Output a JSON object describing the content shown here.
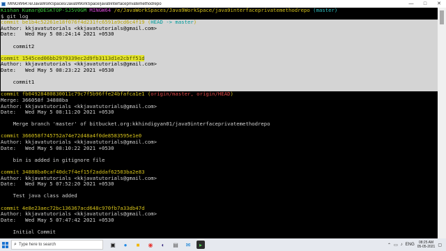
{
  "window": {
    "title": "MINGW64:/e/JavaWorkSpaces/Java9WorkSpace/java9interfaceprivatemethodrepo",
    "minimize_icon": "minimize-icon",
    "maximize_icon": "maximize-icon",
    "close_icon": "close-icon"
  },
  "prompt": {
    "user": "Kishan Kumar@DESKTOP-SJ5V0GM",
    "shell": "MINGW64",
    "path": "/e/JavaWorkSpaces/Java9WorkSpace/java9interfaceprivatemethodrepo",
    "branch": "(master)",
    "command": "$ git log"
  },
  "commits": [
    {
      "commit_line": "commit be1b4c52261e18f076f4d231fc6591a9cd6c4f19",
      "refs_open": " (",
      "refs_head": "HEAD -> master",
      "refs_close": ")",
      "author": "Author: kkjavatutorials <kkjavatutorials@gmail.com>",
      "date": "Date:   Wed May 5 08:24:14 2021 +0530",
      "message": "    commit2"
    },
    {
      "commit_line": "commit 1545ced06bb2979339ec2d9fb3113d1e2cbff51d",
      "author": "Author: kkjavatutorials <kkjavatutorials@gmail.com>",
      "date": "Date:   Wed May 5 08:23:22 2021 +0530",
      "message": "    commit1"
    },
    {
      "commit_line": "commit fb04928480830011c79c7f5b96ffe24bfafca1e1",
      "refs_open": " (",
      "refs_remote": "origin/master, origin/HEAD",
      "refs_close": ")",
      "merge": "Merge: 366058f 34888ba",
      "author": "Author: kkjavatutorials <kkjavatutorials@gmail.com>",
      "date": "Date:   Wed May 5 08:11:20 2021 +0530",
      "message": "    Merge branch 'master' of bitbucket.org:kkhindigyan01/java9interfaceprivatemethodrepo"
    },
    {
      "commit_line": "commit 366058f745752a74e72d48a4f0de8583595e1e0",
      "author": "Author: kkjavatutorials <kkjavatutorials@gmail.com>",
      "date": "Date:   Wed May 5 08:10:22 2021 +0530",
      "message": "    bin is added in gitignore file"
    },
    {
      "commit_line": "commit 34888ba0caf40dc7f4ef15f2addaf62503ba2e83",
      "author": "Author: kkjavatutorials <kkjavatutorials@gmail.com>",
      "date": "Date:   Wed May 5 07:52:20 2021 +0530",
      "message": "    Test java class added"
    },
    {
      "commit_line": "commit 4e8e23aec72bc136367acd648c970fb7a33db47d",
      "author": "Author: kkjavatutorials <kkjavatutorials@gmail.com>",
      "date": "Date:   Wed May 5 07:47:42 2021 +0530",
      "message": "    Initial Commit"
    }
  ],
  "taskbar": {
    "search_placeholder": "Type here to search",
    "tray_lang": "ENG",
    "time": "08:25 AM",
    "date": "05-05-2021",
    "icons": [
      "windows-icon",
      "search-icon",
      "task-view-icon",
      "edge-icon",
      "file-explorer-icon",
      "chrome-icon",
      "eclipse-icon",
      "store-icon",
      "mail-icon",
      "git-bash-icon"
    ]
  },
  "colors": {
    "prompt_user": "#3ec83e",
    "prompt_shell": "#d848d8",
    "prompt_path": "#d8c41b",
    "branch": "#2fc3c3",
    "commit_hash": "#d8c41b",
    "head_ref": "#2fc3c3",
    "remote_ref": "#e04848",
    "selection_bg": "#d4d4d4",
    "highlight_bg": "#e3e42b"
  }
}
